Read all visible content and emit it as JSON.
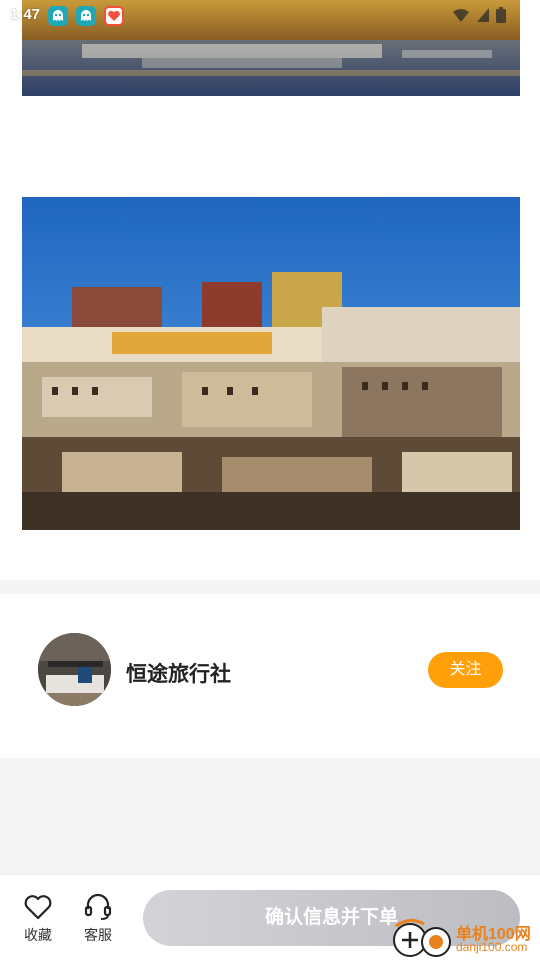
{
  "status_bar": {
    "time": "1:47",
    "app_icons": [
      "ghost-app-icon",
      "ghost-app-icon",
      "heart-app-icon"
    ],
    "system_icons": [
      "wifi-icon",
      "signal-icon",
      "battery-icon"
    ]
  },
  "gallery": {
    "photos": [
      "lake-reflection-photo",
      "monastery-photo"
    ]
  },
  "agency": {
    "name": "恒途旅行社",
    "follow_label": "关注",
    "follow_color": "#ff9f0a"
  },
  "bottom_bar": {
    "favorite_label": "收藏",
    "service_label": "客服",
    "order_label": "确认信息并下单"
  },
  "watermark": {
    "line1": "单机100网",
    "line2": "danji100.com"
  }
}
